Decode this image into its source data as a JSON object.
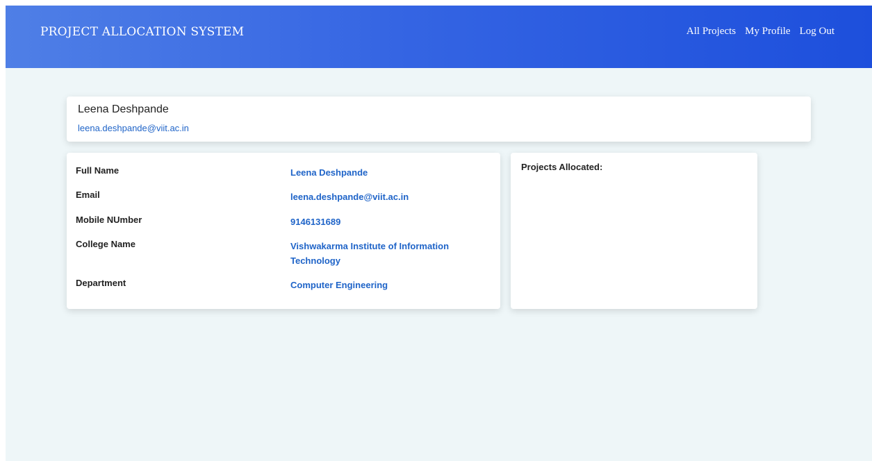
{
  "navbar": {
    "brand": "PROJECT ALLOCATION SYSTEM",
    "links": [
      {
        "label": "All Projects"
      },
      {
        "label": "My Profile"
      },
      {
        "label": "Log Out"
      }
    ]
  },
  "profile_header": {
    "name": "Leena Deshpande",
    "email": "leena.deshpande@viit.ac.in"
  },
  "details": [
    {
      "label": "Full Name",
      "value": "Leena Deshpande"
    },
    {
      "label": "Email",
      "value": "leena.deshpande@viit.ac.in"
    },
    {
      "label": "Mobile NUmber",
      "value": "9146131689"
    },
    {
      "label": "College Name",
      "value": "Vishwakarma Institute of Information Technology"
    },
    {
      "label": "Department",
      "value": "Computer Engineering"
    }
  ],
  "projects": {
    "title": "Projects Allocated:"
  },
  "colors": {
    "accent": "#1f64c8",
    "navbar_start": "#4f7fe6",
    "navbar_end": "#1d4fdc",
    "background": "#eef6f8"
  }
}
